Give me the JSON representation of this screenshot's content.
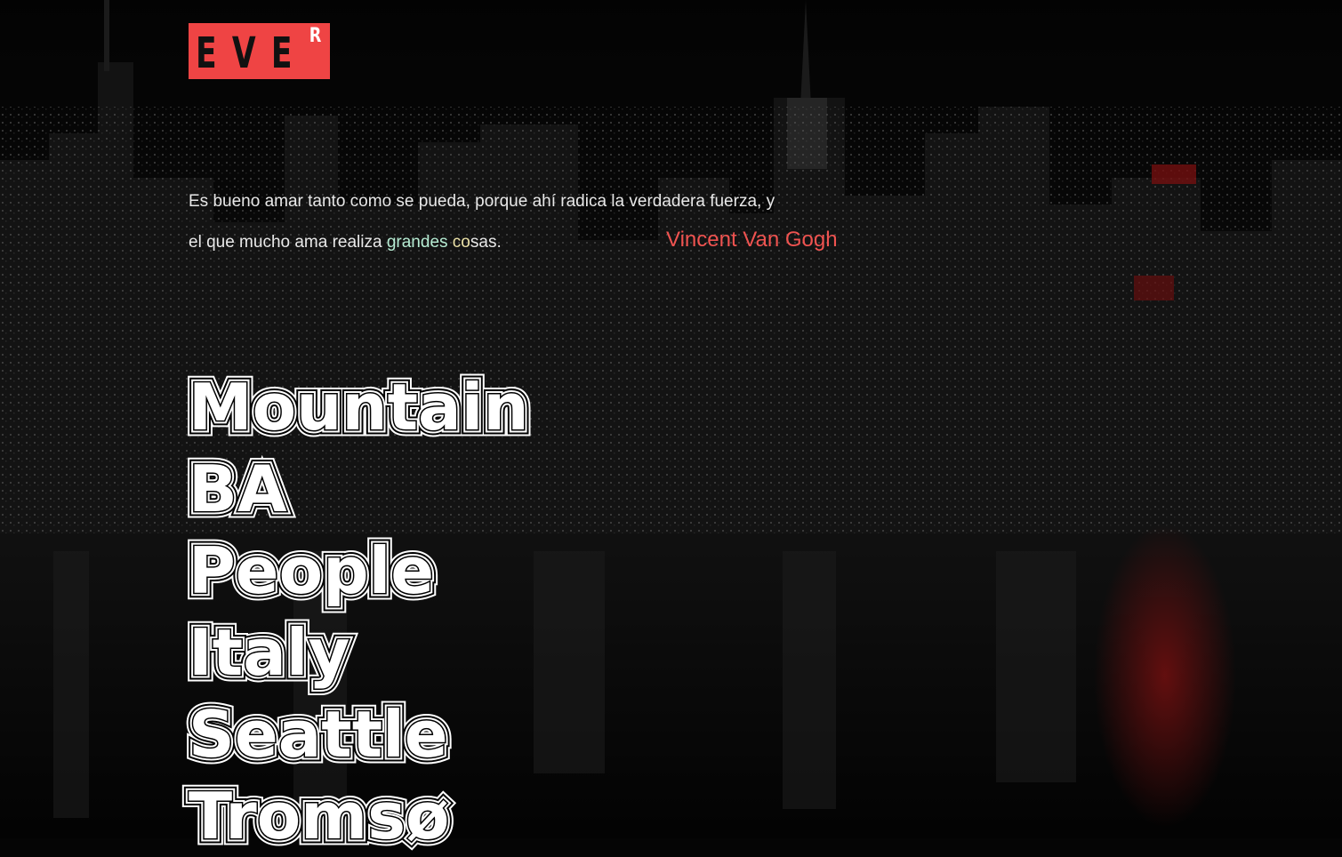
{
  "logo": {
    "text": "EVE",
    "superscript": "R",
    "background_color": "#ef4444"
  },
  "quote": {
    "line1": "Es bueno amar tanto como se pueda, porque ahí radica la verdadera fuerza, y",
    "line2_start": "el que mucho ama realiza ",
    "line2_green": "grandes ",
    "line2_yellow": "co",
    "line2_end": "sas.",
    "author": "Vincent Van Gogh",
    "author_color": "#ef5350"
  },
  "cities": [
    "Mountain",
    "BA",
    "People",
    "Italy",
    "Seattle",
    "Tromsø"
  ],
  "colors": {
    "background": "#050505",
    "accent": "#ef4444",
    "text": "#e8e8e8"
  }
}
